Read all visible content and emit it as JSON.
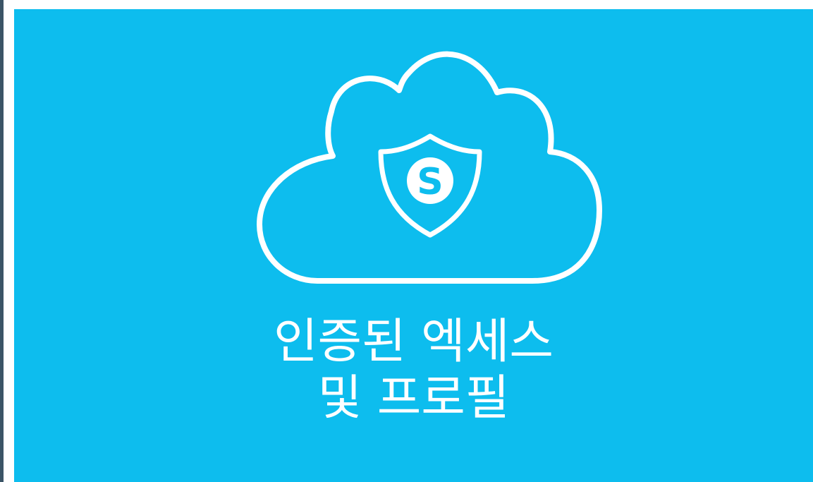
{
  "colors": {
    "background": "#0dbdee",
    "foreground": "#ffffff",
    "left_rule": "#3b5466"
  },
  "logo": {
    "icon": "secure-cloud-shield-icon",
    "badge_letter": "S"
  },
  "caption": {
    "line1": "인증된 엑세스",
    "line2": "및 프로필"
  }
}
